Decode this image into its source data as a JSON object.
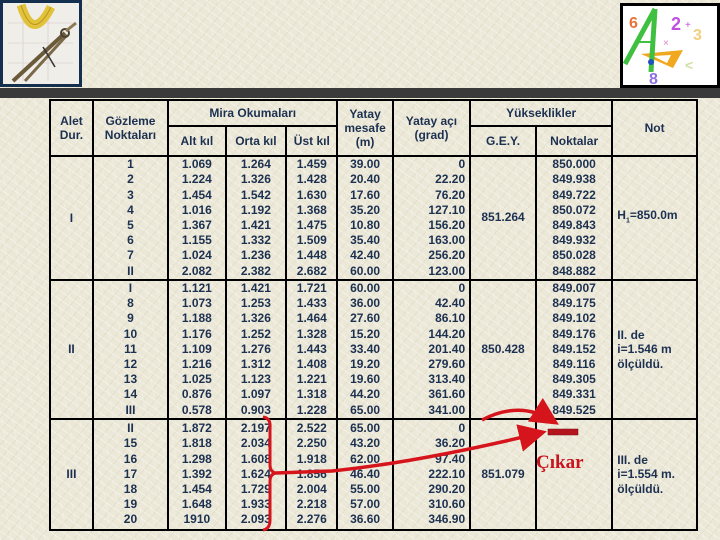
{
  "header": {
    "left_image": "compass-and-protractor-illustration",
    "right_image": "math-geometry-illustration"
  },
  "table": {
    "headers": {
      "alet": "Alet Dur.",
      "gozleme": "Gözleme Noktaları",
      "mira": "Mira Okumaları",
      "alt": "Alt kıl",
      "orta": "Orta kıl",
      "ust": "Üst kıl",
      "yatay_mesafe": "Yatay mesafe (m)",
      "yatay_aci": "Yatay açı (grad)",
      "yukseklikler": "Yükseklikler",
      "gey": "G.E.Y.",
      "noktalar": "Noktalar",
      "not": "Not"
    },
    "groups": [
      {
        "station": "I",
        "points": "1\n2\n3\n4\n5\n6\n7\nII",
        "alt": "1.069\n1.224\n1.454\n1.016\n1.367\n1.155\n1.024\n2.082",
        "orta": "1.264\n1.326\n1.542\n1.192\n1.421\n1.332\n1.236\n2.382",
        "ust": "1.459\n1.428\n1.630\n1.368\n1.475\n1.509\n1.448\n2.682",
        "mesafe": "39.00\n20.40\n17.60\n35.20\n10.80\n35.40\n42.40\n60.00",
        "aci": "0\n22.20\n76.20\n127.10\n156.20\n163.00\n256.20\n123.00",
        "gey": "851.264",
        "noktalar": "850.000\n849.938\n849.722\n850.072\n849.843\n849.932\n850.028\n848.882",
        "note_prefix": "H",
        "note_sub": "1",
        "note_suffix": "=850.0m"
      },
      {
        "station": "II",
        "points": "I\n8\n9\n10\n11\n12\n13\n14\nIII",
        "alt": "1.121\n1.073\n1.188\n1.176\n1.109\n1.216\n1.025\n0.876\n0.578",
        "orta": "1.421\n1.253\n1.326\n1.252\n1.276\n1.312\n1.123\n1.097\n0.903",
        "ust": "1.721\n1.433\n1.464\n1.328\n1.443\n1.408\n1.221\n1.318\n1.228",
        "mesafe": "60.00\n36.00\n27.60\n15.20\n33.40\n19.20\n19.60\n44.20\n65.00",
        "aci": "0\n42.40\n86.10\n144.20\n201.40\n279.60\n313.40\n361.60\n341.00",
        "gey": "850.428",
        "noktalar": "849.007\n849.175\n849.102\n849.176\n849.152\n849.116\n849.305\n849.331\n849.525",
        "note": "II. de\ni=1.546 m\nölçüldü."
      },
      {
        "station": "III",
        "points": "II\n15\n16\n17\n18\n19\n20",
        "alt": "1.872\n1.818\n1.298\n1.392\n1.454\n1.648\n1910",
        "orta": "2.197\n2.034\n1.608\n1.624\n1.729\n1.933\n2.093",
        "ust": "2.522\n2.250\n1.918\n1.856\n2.004\n2.218\n2.276",
        "mesafe": "65.00\n43.20\n62.00\n46.40\n55.00\n57.00\n36.60",
        "aci": "0\n36.20\n97.40\n222.10\n290.20\n310.60\n346.90",
        "gey": "851.079",
        "noktalar": "",
        "note": "III. de\ni=1.554 m.\nölçüldü."
      }
    ]
  },
  "annotation": {
    "label": "Çıkar",
    "color": "#c8141e",
    "symbol": "minus"
  }
}
